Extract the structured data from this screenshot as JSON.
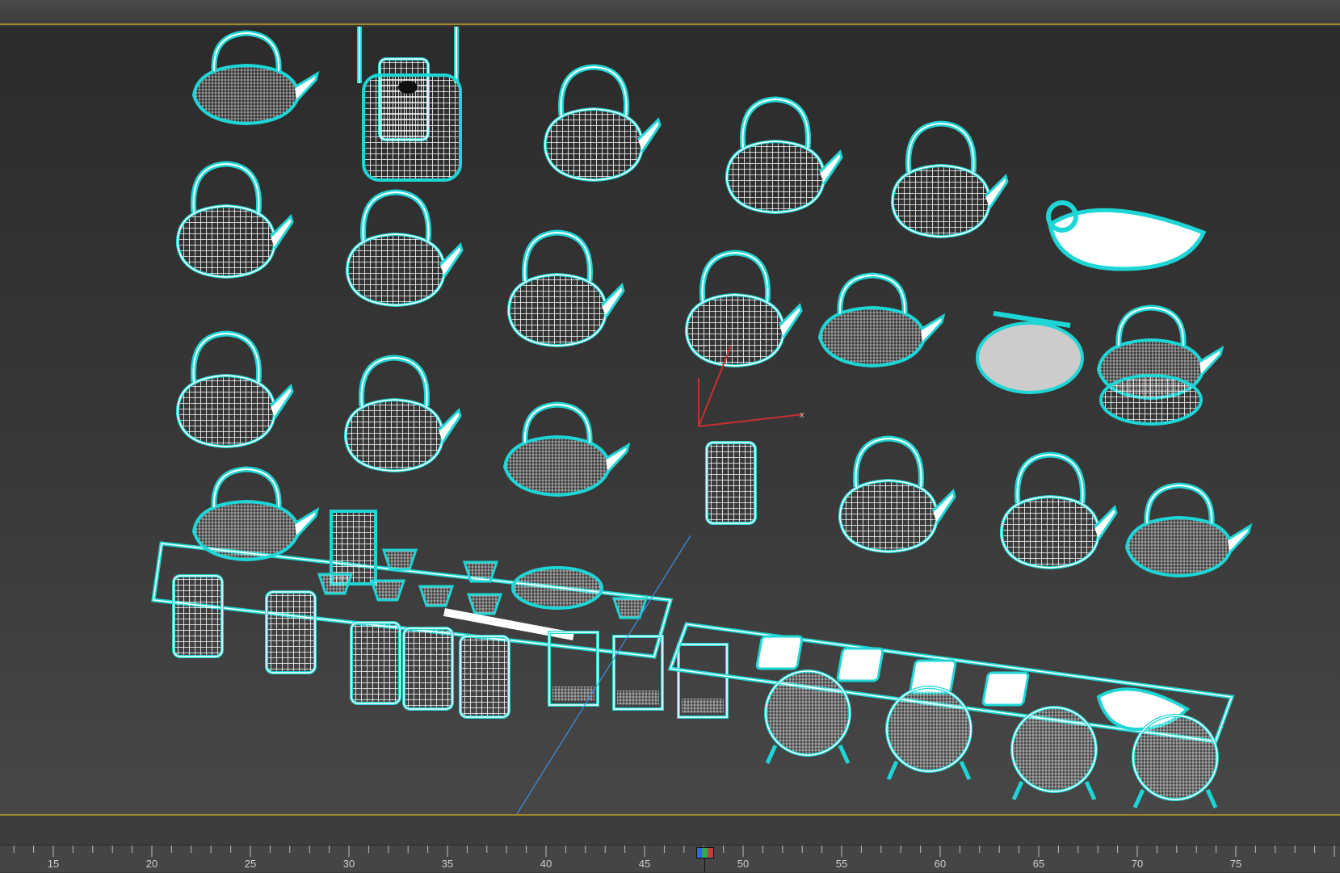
{
  "viewport": {
    "selection_color": "#1ed6d6",
    "wire_color": "#ffffff",
    "gizmo_axis_label": "x"
  },
  "timeline": {
    "tick_labels": [
      "15",
      "20",
      "25",
      "30",
      "35",
      "40",
      "45",
      "50",
      "55",
      "60",
      "65",
      "70",
      "75"
    ],
    "current_frame_marker": "time-slider",
    "slider_colors": [
      "#2f6ad6",
      "#2db04b",
      "#c24040"
    ]
  }
}
